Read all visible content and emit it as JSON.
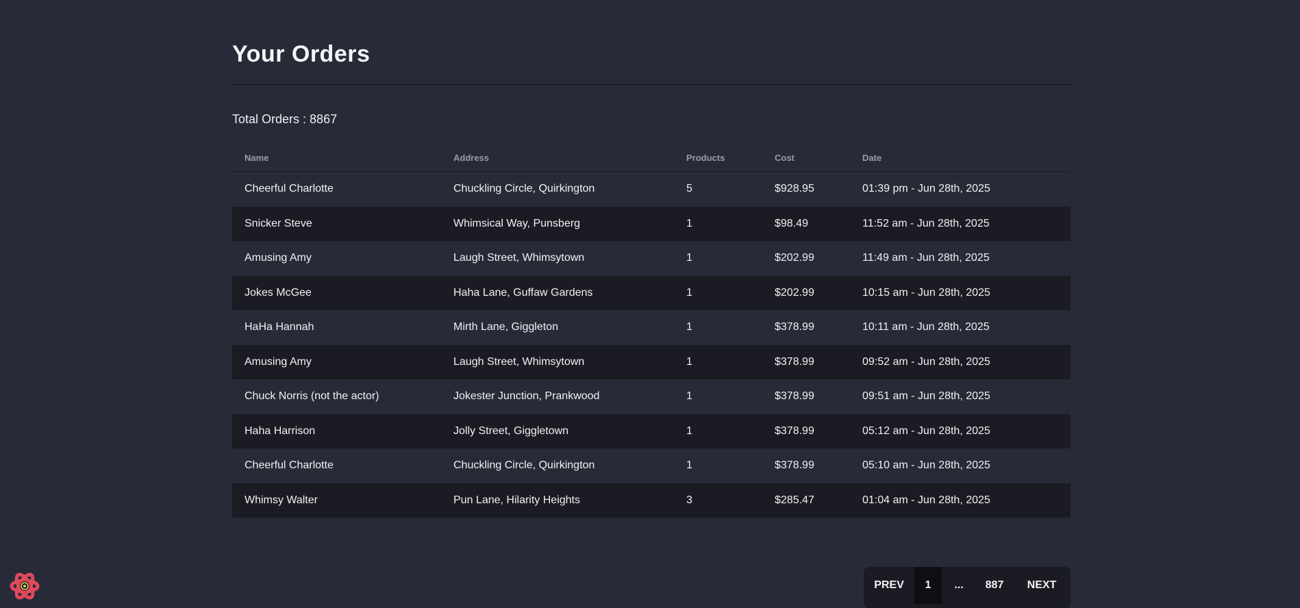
{
  "page": {
    "title": "Your Orders",
    "total_label": "Total Orders : ",
    "total_count": "8867"
  },
  "table": {
    "headers": {
      "name": "Name",
      "address": "Address",
      "products": "Products",
      "cost": "Cost",
      "date": "Date"
    },
    "rows": [
      {
        "name": "Cheerful Charlotte",
        "address": "Chuckling Circle, Quirkington",
        "products": "5",
        "cost": "$928.95",
        "date": "01:39 pm - Jun 28th, 2025"
      },
      {
        "name": "Snicker Steve",
        "address": "Whimsical Way, Punsberg",
        "products": "1",
        "cost": "$98.49",
        "date": "11:52 am - Jun 28th, 2025"
      },
      {
        "name": "Amusing Amy",
        "address": "Laugh Street, Whimsytown",
        "products": "1",
        "cost": "$202.99",
        "date": "11:49 am - Jun 28th, 2025"
      },
      {
        "name": "Jokes McGee",
        "address": "Haha Lane, Guffaw Gardens",
        "products": "1",
        "cost": "$202.99",
        "date": "10:15 am - Jun 28th, 2025"
      },
      {
        "name": "HaHa Hannah",
        "address": "Mirth Lane, Giggleton",
        "products": "1",
        "cost": "$378.99",
        "date": "10:11 am - Jun 28th, 2025"
      },
      {
        "name": "Amusing Amy",
        "address": "Laugh Street, Whimsytown",
        "products": "1",
        "cost": "$378.99",
        "date": "09:52 am - Jun 28th, 2025"
      },
      {
        "name": "Chuck Norris (not the actor)",
        "address": "Jokester Junction, Prankwood",
        "products": "1",
        "cost": "$378.99",
        "date": "09:51 am - Jun 28th, 2025"
      },
      {
        "name": "Haha Harrison",
        "address": "Jolly Street, Giggletown",
        "products": "1",
        "cost": "$378.99",
        "date": "05:12 am - Jun 28th, 2025"
      },
      {
        "name": "Cheerful Charlotte",
        "address": "Chuckling Circle, Quirkington",
        "products": "1",
        "cost": "$378.99",
        "date": "05:10 am - Jun 28th, 2025"
      },
      {
        "name": "Whimsy Walter",
        "address": "Pun Lane, Hilarity Heights",
        "products": "3",
        "cost": "$285.47",
        "date": "01:04 am - Jun 28th, 2025"
      }
    ]
  },
  "pagination": {
    "prev": "PREV",
    "current": "1",
    "ellipsis": "...",
    "last": "887",
    "next": "NEXT"
  },
  "icons": {
    "devtools": "react-logo-icon"
  },
  "colors": {
    "background": "#272a37",
    "row_alt": "#1a1b23",
    "active_page": "#0e0f13",
    "react_logo": "#e0495b"
  }
}
